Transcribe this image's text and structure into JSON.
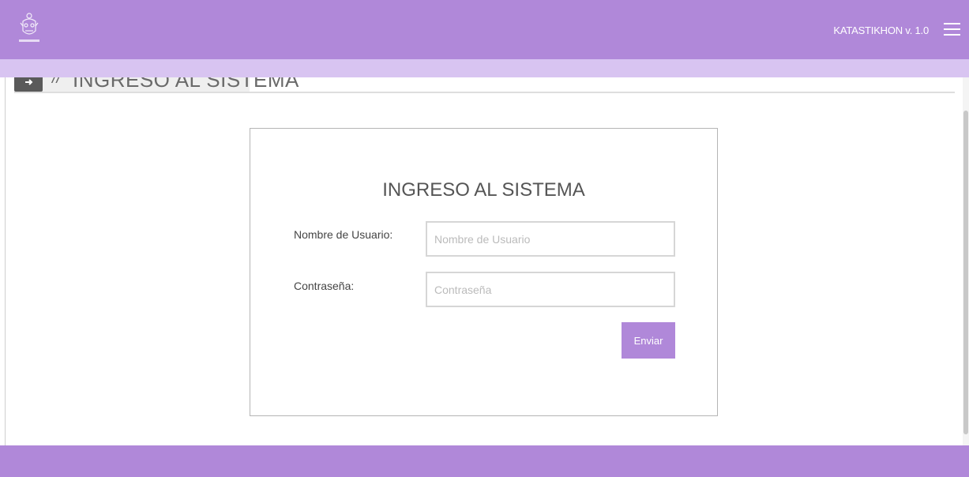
{
  "header": {
    "brand": "KATASTIKHON  v. 1.0",
    "logo_icon": "crest-logo-icon",
    "menu_icon": "hamburger-menu-icon"
  },
  "breadcrumb": {
    "icon": "login-arrow-icon",
    "separator": "//",
    "title": "INGRESO AL SISTEMA"
  },
  "login": {
    "title": "INGRESO AL SISTEMA",
    "username_label": "Nombre de Usuario:",
    "username_placeholder": "Nombre de Usuario",
    "username_value": "",
    "password_label": "Contraseña:",
    "password_placeholder": "Contraseña",
    "password_value": "",
    "submit_label": "Enviar"
  },
  "colors": {
    "primary": "#b088d9",
    "subbar": "#d8c4f1",
    "text": "#555555"
  }
}
